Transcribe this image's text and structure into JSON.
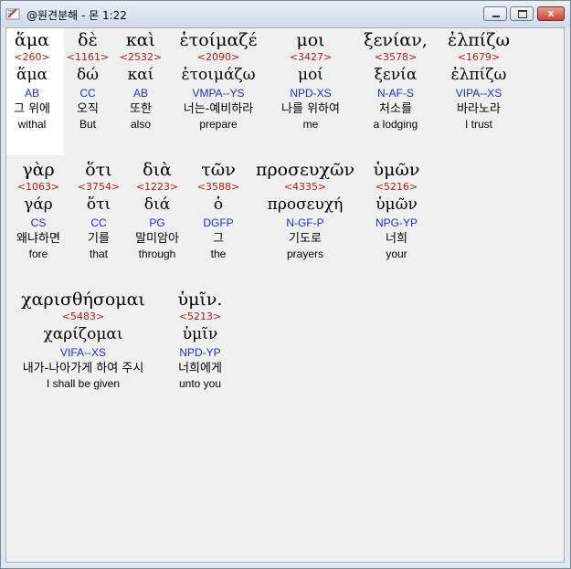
{
  "window": {
    "title": "@원견분해 - 몬 1:22",
    "close_label": "x"
  },
  "lines": [
    {
      "words": [
        {
          "greek": "ἅμα",
          "strong": "<260>",
          "lemma": "ἅμα",
          "parsing": "AB",
          "korean": "그 위에",
          "english": "withal"
        },
        {
          "greek": "δὲ",
          "strong": "<1161>",
          "lemma": "δώ",
          "parsing": "CC",
          "korean": "오직",
          "english": "But"
        },
        {
          "greek": "καὶ",
          "strong": "<2532>",
          "lemma": "καί",
          "parsing": "AB",
          "korean": "또한",
          "english": "also"
        },
        {
          "greek": "ἑτοίμαζέ",
          "strong": "<2090>",
          "lemma": "ἑτοιμάζω",
          "parsing": "VMPA--YS",
          "korean": "너는-예비하라",
          "english": "prepare"
        },
        {
          "greek": "μοι",
          "strong": "<3427>",
          "lemma": "μοί",
          "parsing": "NPD-XS",
          "korean": "나를 위하여",
          "english": "me"
        },
        {
          "greek": "ξενίαν,",
          "strong": "<3578>",
          "lemma": "ξενία",
          "parsing": "N-AF-S",
          "korean": "처소를",
          "english": "a lodging"
        },
        {
          "greek": "ἐλπίζω",
          "strong": "<1679>",
          "lemma": "ἐλπίζω",
          "parsing": "VIPA--XS",
          "korean": "바라노라",
          "english": "I trust"
        }
      ]
    },
    {
      "words": [
        {
          "greek": "γὰρ",
          "strong": "<1063>",
          "lemma": "γάρ",
          "parsing": "CS",
          "korean": "왜냐하면",
          "english": "fore"
        },
        {
          "greek": "ὅτι",
          "strong": "<3754>",
          "lemma": "ὅτι",
          "parsing": "CC",
          "korean": "기를",
          "english": "that"
        },
        {
          "greek": "διὰ",
          "strong": "<1223>",
          "lemma": "διά",
          "parsing": "PG",
          "korean": "말미암아",
          "english": "through"
        },
        {
          "greek": "τῶν",
          "strong": "<3588>",
          "lemma": "ὁ",
          "parsing": "DGFP",
          "korean": "그",
          "english": "the"
        },
        {
          "greek": "προσευχῶν",
          "strong": "<4335>",
          "lemma": "προσευχή",
          "parsing": "N-GF-P",
          "korean": "기도로",
          "english": "prayers"
        },
        {
          "greek": "ὑμῶν",
          "strong": "<5216>",
          "lemma": "ὑμῶν",
          "parsing": "NPG-YP",
          "korean": "너희",
          "english": "your"
        }
      ]
    },
    {
      "words": [
        {
          "greek": "χαρισθήσομαι",
          "strong": "<5483>",
          "lemma": "χαρίζομαι",
          "parsing": "VIFA--XS",
          "korean": "내가-나아가게 하여 주시",
          "english": "I shall be given"
        },
        {
          "greek": "ὑμῖν.",
          "strong": "<5213>",
          "lemma": "ὑμῖν",
          "parsing": "NPD-YP",
          "korean": "너희에게",
          "english": "unto you"
        }
      ]
    }
  ]
}
